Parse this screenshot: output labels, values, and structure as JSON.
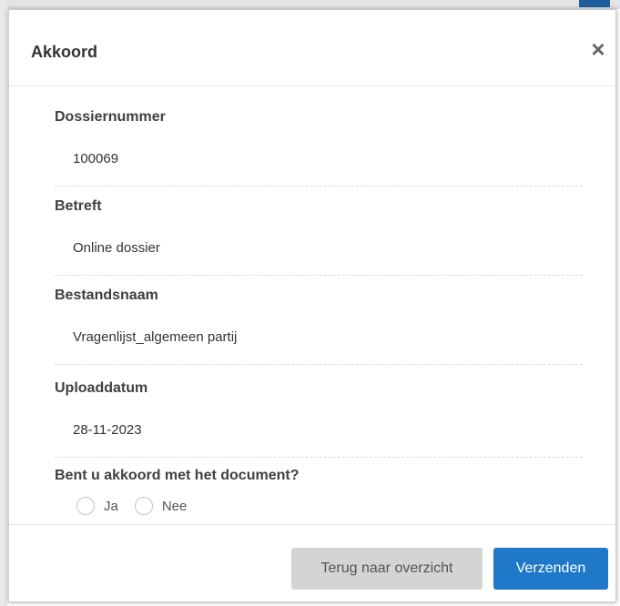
{
  "dialog": {
    "title": "Akkoord",
    "close_symbol": "×"
  },
  "fields": [
    {
      "label": "Dossiernummer",
      "value": "100069"
    },
    {
      "label": "Betreft",
      "value": "Online dossier"
    },
    {
      "label": "Bestandsnaam",
      "value": "Vragenlijst_algemeen partij"
    },
    {
      "label": "Uploaddatum",
      "value": "28-11-2023"
    }
  ],
  "agreement": {
    "question": "Bent u akkoord met het document?",
    "options": [
      {
        "label": "Ja",
        "selected": false
      },
      {
        "label": "Nee",
        "selected": false
      }
    ]
  },
  "footer": {
    "back_label": "Terug naar overzicht",
    "submit_label": "Verzenden"
  },
  "colors": {
    "primary": "#1f78c8",
    "secondary": "#d4d4d4",
    "label_text": "#404040"
  },
  "icons": {
    "close": "close-icon"
  }
}
